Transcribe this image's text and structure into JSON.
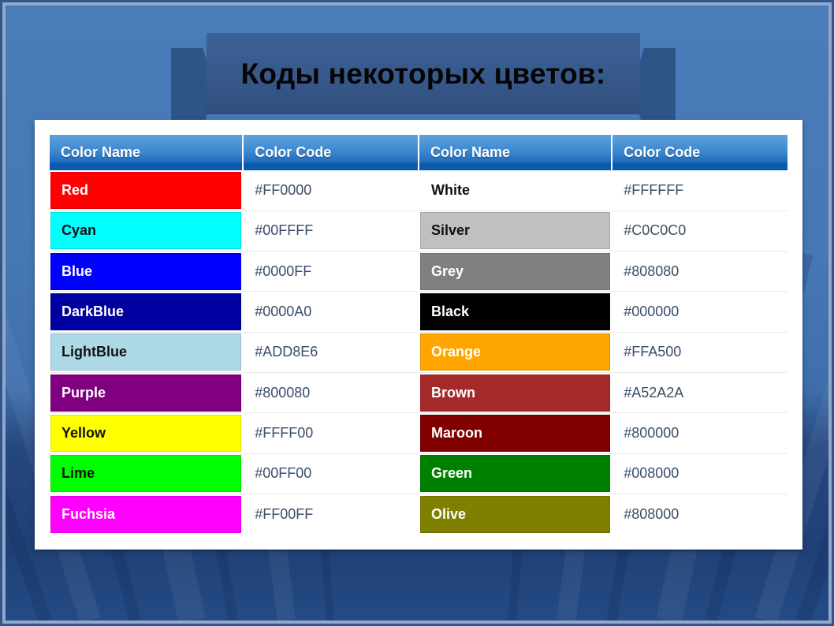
{
  "slide": {
    "title": "Коды некоторых цветов:",
    "background_top": "#4a7cba",
    "background_bottom": "#1f4076",
    "ribbon_color": "#2f5587",
    "title_bar_color": "#37588a",
    "panel_background": "#ffffff"
  },
  "table": {
    "header_accent": "#0a5aad",
    "code_text_color": "#3a4e68",
    "headers": [
      "Color Name",
      "Color Code",
      "Color Name",
      "Color Code"
    ],
    "rows": [
      {
        "left": {
          "name": "Red",
          "code": "#FF0000",
          "swatch": "#FF0000",
          "text": "#ffffff"
        },
        "right": {
          "name": "White",
          "code": "#FFFFFF",
          "swatch": "#FFFFFF",
          "text": "#111111"
        }
      },
      {
        "left": {
          "name": "Cyan",
          "code": "#00FFFF",
          "swatch": "#00FFFF",
          "text": "#111111"
        },
        "right": {
          "name": "Silver",
          "code": "#C0C0C0",
          "swatch": "#C0C0C0",
          "text": "#111111"
        }
      },
      {
        "left": {
          "name": "Blue",
          "code": "#0000FF",
          "swatch": "#0000FF",
          "text": "#ffffff"
        },
        "right": {
          "name": "Grey",
          "code": "#808080",
          "swatch": "#808080",
          "text": "#ffffff"
        }
      },
      {
        "left": {
          "name": "DarkBlue",
          "code": "#0000A0",
          "swatch": "#0000A0",
          "text": "#ffffff"
        },
        "right": {
          "name": "Black",
          "code": "#000000",
          "swatch": "#000000",
          "text": "#ffffff"
        }
      },
      {
        "left": {
          "name": "LightBlue",
          "code": "#ADD8E6",
          "swatch": "#ADD8E6",
          "text": "#111111"
        },
        "right": {
          "name": "Orange",
          "code": "#FFA500",
          "swatch": "#FFA500",
          "text": "#ffffff"
        }
      },
      {
        "left": {
          "name": "Purple",
          "code": "#800080",
          "swatch": "#800080",
          "text": "#ffffff"
        },
        "right": {
          "name": "Brown",
          "code": "#A52A2A",
          "swatch": "#A52A2A",
          "text": "#ffffff"
        }
      },
      {
        "left": {
          "name": "Yellow",
          "code": "#FFFF00",
          "swatch": "#FFFF00",
          "text": "#111111"
        },
        "right": {
          "name": "Maroon",
          "code": "#800000",
          "swatch": "#800000",
          "text": "#ffffff"
        }
      },
      {
        "left": {
          "name": "Lime",
          "code": "#00FF00",
          "swatch": "#00FF00",
          "text": "#111111"
        },
        "right": {
          "name": "Green",
          "code": "#008000",
          "swatch": "#008000",
          "text": "#ffffff"
        }
      },
      {
        "left": {
          "name": "Fuchsia",
          "code": "#FF00FF",
          "swatch": "#FF00FF",
          "text": "#ffffff"
        },
        "right": {
          "name": "Olive",
          "code": "#808000",
          "swatch": "#808000",
          "text": "#ffffff"
        }
      }
    ]
  }
}
